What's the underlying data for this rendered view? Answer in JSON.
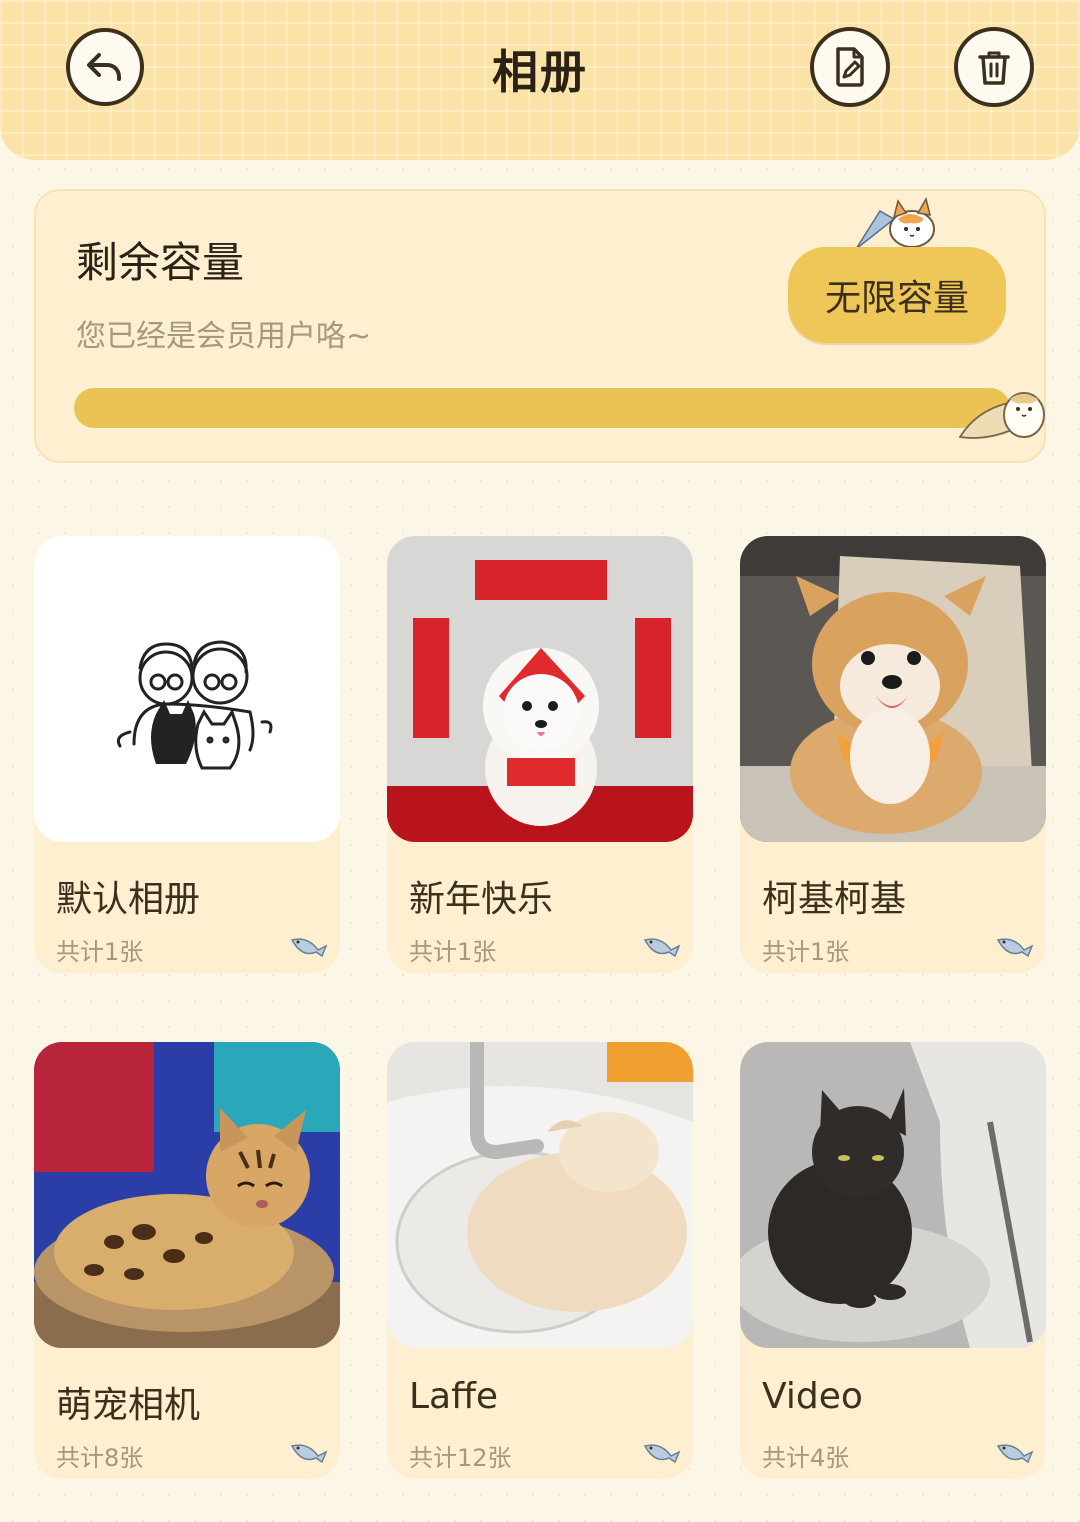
{
  "header": {
    "title": "相册",
    "back_icon": "back-arrow-icon",
    "edit_icon": "edit-document-icon",
    "delete_icon": "trash-icon"
  },
  "capacity": {
    "title": "剩余容量",
    "subtitle": "您已经是会员用户咯~",
    "button_label": "无限容量",
    "progress_fraction": 1.0,
    "accent_color": "#EBC254"
  },
  "albums": [
    {
      "name": "默认相册",
      "count": "共计1张",
      "thumb": "couple-sketch-with-pets"
    },
    {
      "name": "新年快乐",
      "count": "共计1张",
      "thumb": "white-puppy-new-year"
    },
    {
      "name": "柯基柯基",
      "count": "共计1张",
      "thumb": "corgi-on-chair"
    },
    {
      "name": "萌宠相机",
      "count": "共计8张",
      "thumb": "bengal-cat"
    },
    {
      "name": "Laffe",
      "count": "共计12张",
      "thumb": "fluffy-pet-in-sink"
    },
    {
      "name": "Video",
      "count": "共计4张",
      "thumb": "black-cat-on-chair"
    }
  ],
  "colors": {
    "background": "#FCF6E6",
    "header": "#FBE3A7",
    "card": "#FDEFCF",
    "text_dark": "#3B2F1E",
    "text_muted": "#A39882"
  }
}
